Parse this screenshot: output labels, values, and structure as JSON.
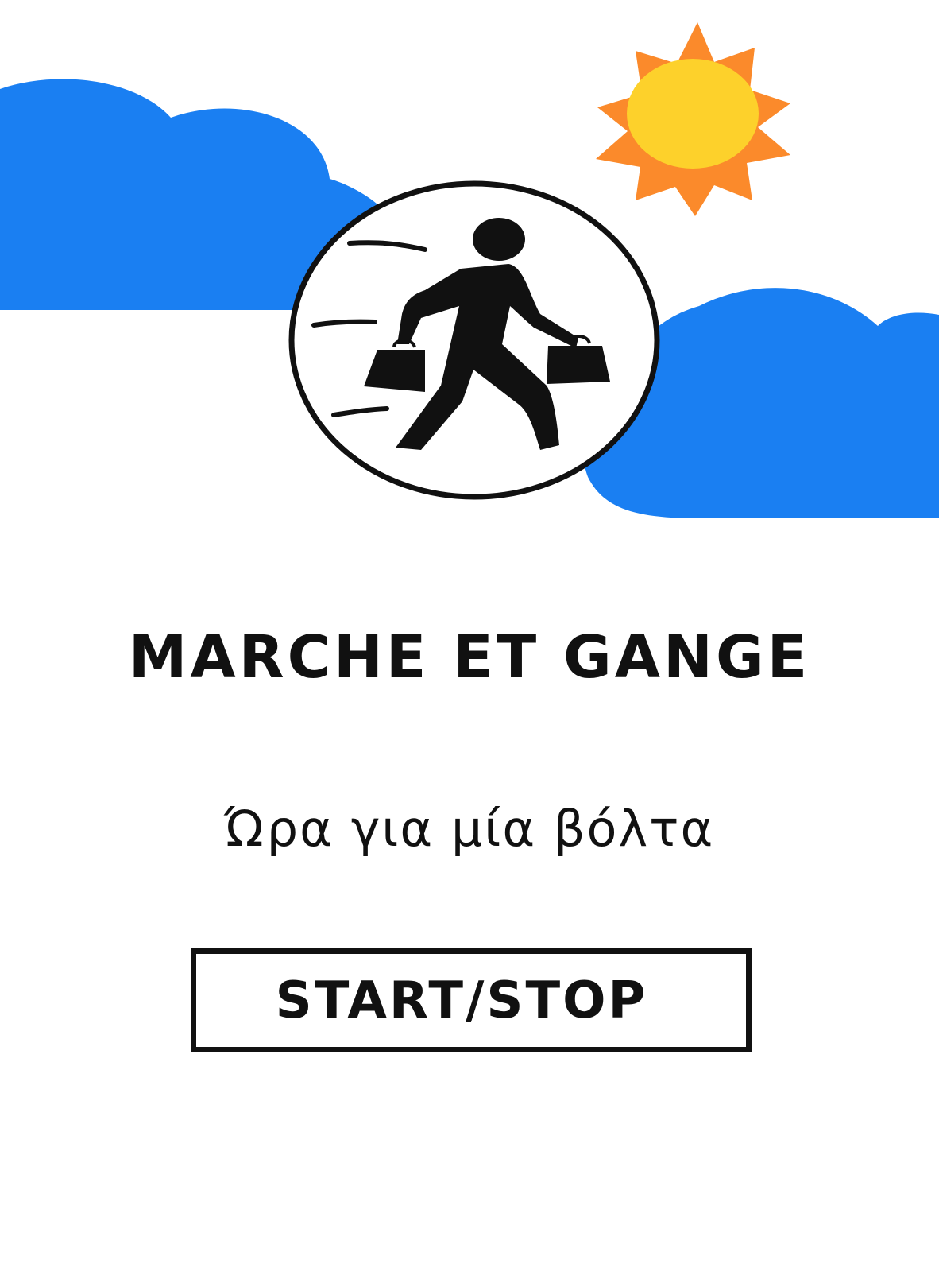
{
  "app": {
    "title": "MARCHE ET GANGE",
    "subtitle": "Ώρα για μία βόλτα",
    "start_stop_label": "START/STOP"
  },
  "icons": {
    "logo": "walking-shopper-icon",
    "sun": "sun-icon",
    "clouds": "cloud-icon"
  },
  "colors": {
    "cloud": "#1a7ff2",
    "sun_core": "#fdd12b",
    "sun_rays": "#fb8a2b",
    "ink": "#111111",
    "background": "#ffffff"
  }
}
